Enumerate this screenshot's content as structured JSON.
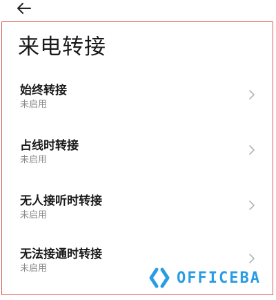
{
  "header": {
    "back_icon": "arrow-left-icon"
  },
  "page": {
    "title": "来电转接"
  },
  "items": [
    {
      "title": "始终转接",
      "status": "未启用"
    },
    {
      "title": "占线时转接",
      "status": "未启用"
    },
    {
      "title": "无人接听时转接",
      "status": "未启用"
    },
    {
      "title": "无法接通时转接",
      "status": "未启用"
    }
  ],
  "watermark": {
    "text": "OFFICEBA",
    "color": "#2a9ce4"
  },
  "colors": {
    "text": "#1a1a1a",
    "subtext": "#8a8a8a",
    "frame": "#d9534f",
    "chevron": "#b5b5b5"
  }
}
